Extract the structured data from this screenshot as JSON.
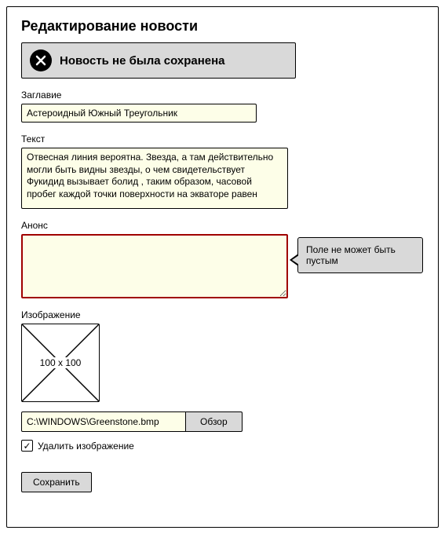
{
  "page_title": "Редактирование новости",
  "alert": {
    "text": "Новость не была сохранена"
  },
  "fields": {
    "title": {
      "label": "Заглавие",
      "value": "Астероидный Южный Треугольник"
    },
    "text": {
      "label": "Текст",
      "value": "Отвесная линия вероятна. Звезда, а там действительно могли быть видны звезды, о чем свидетельствует Фукидид вызывает болид , таким образом, часовой пробег каждой точки поверхности на экваторе равен"
    },
    "announce": {
      "label": "Анонс",
      "value": "",
      "error": "Поле не может быть пустым"
    },
    "image": {
      "label": "Изображение",
      "placeholder_size": "100 x 100",
      "file_path": "C:\\WINDOWS\\Greenstone.bmp",
      "browse_label": "Обзор",
      "delete_label": "Удалить изображение",
      "delete_checked": "✓"
    }
  },
  "actions": {
    "save": "Сохранить"
  }
}
